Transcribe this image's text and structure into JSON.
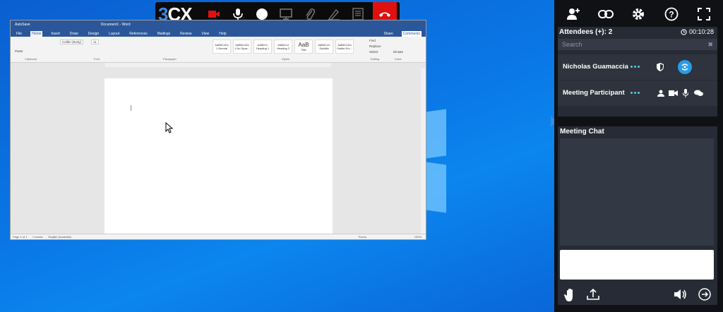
{
  "toolbar": {
    "logo_three": "3",
    "logo_cx": "CX",
    "buttons": [
      "camera-off-icon",
      "microphone-icon",
      "record-icon",
      "screen-share-icon",
      "attachment-icon",
      "whiteboard-icon",
      "notes-icon",
      "hangup-icon"
    ],
    "hangup_color": "#e01010",
    "accent": "#3a8be0"
  },
  "word": {
    "title_left": "AutoSave",
    "title_doc": "Document1 - Word",
    "tabs": [
      "File",
      "Home",
      "Insert",
      "Draw",
      "Design",
      "Layout",
      "References",
      "Mailings",
      "Review",
      "View",
      "Help"
    ],
    "share": "Share",
    "comments": "Comments",
    "groups": [
      "Clipboard",
      "Font",
      "Paragraph",
      "Styles",
      "Editing",
      "Voice"
    ],
    "paste_label": "Paste",
    "font_name": "Calibri (Body)",
    "font_size": "11",
    "styles": [
      {
        "preview": "AaBbCcDc",
        "name": "1 Normal"
      },
      {
        "preview": "AaBbCcDc",
        "name": "1 No Spac..."
      },
      {
        "preview": "AaBbCc",
        "name": "Heading 1"
      },
      {
        "preview": "AaBbCcI",
        "name": "Heading 2"
      },
      {
        "preview": "AaB",
        "name": "Title"
      },
      {
        "preview": "AaBbCcC",
        "name": "Subtitle"
      },
      {
        "preview": "AaBbCcDc",
        "name": "Subtle Em..."
      }
    ],
    "editing": [
      "Find",
      "Replace",
      "Select"
    ],
    "dictate": "Dictate",
    "status_page": "Page 1 of 1",
    "status_words": "0 words",
    "status_lang": "English (Australia)",
    "status_focus": "Focus",
    "zoom": "100%"
  },
  "panel": {
    "attendees_label": "Attendees (+): 2",
    "timer": "00:10:28",
    "search_placeholder": "Search",
    "attendees": [
      {
        "name": "Nicholas Guamaccia"
      },
      {
        "name": "Meeting Participant"
      }
    ],
    "chat_title": "Meeting Chat",
    "colors": {
      "panel_bg": "#0f1114",
      "card_bg": "#272b35",
      "row_bg": "#2e333e",
      "dots": "#5ad0e0",
      "badge": "#2a9be6"
    }
  }
}
